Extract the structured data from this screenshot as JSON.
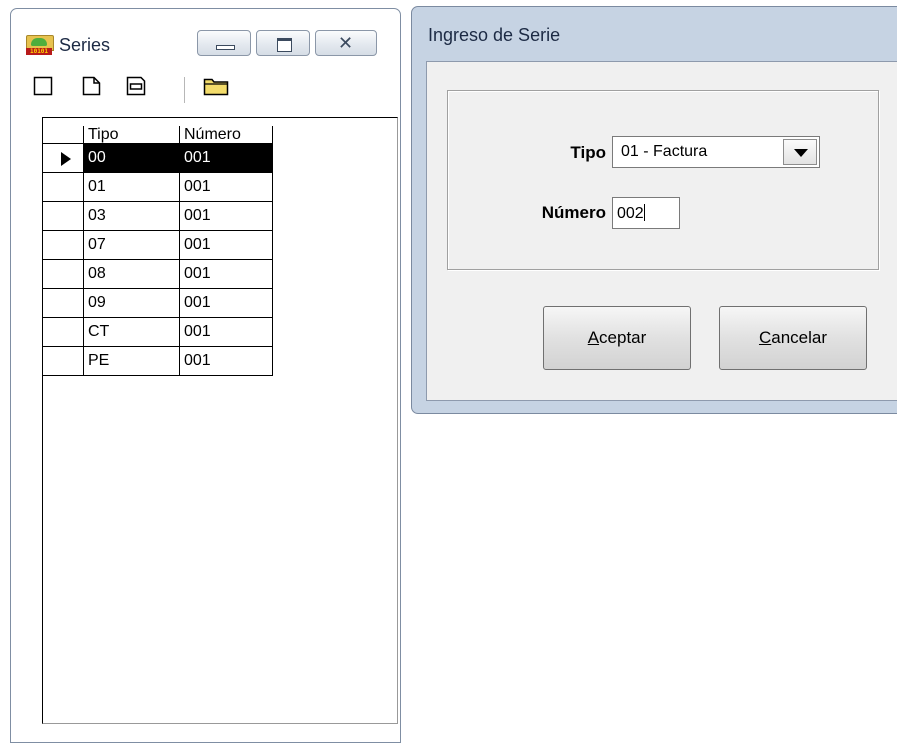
{
  "series_window": {
    "title": "Series",
    "toolbar": {
      "icons": [
        "new-blank-icon",
        "new-document-icon",
        "save-icon",
        "open-folder-icon"
      ]
    },
    "grid": {
      "columns": [
        "Tipo",
        "Número"
      ],
      "rows": [
        {
          "tipo": "00",
          "numero": "001",
          "selected": true
        },
        {
          "tipo": "01",
          "numero": "001"
        },
        {
          "tipo": "03",
          "numero": "001"
        },
        {
          "tipo": "07",
          "numero": "001"
        },
        {
          "tipo": "08",
          "numero": "001"
        },
        {
          "tipo": "09",
          "numero": "001"
        },
        {
          "tipo": "CT",
          "numero": "001"
        },
        {
          "tipo": "PE",
          "numero": "001"
        }
      ]
    }
  },
  "dialog": {
    "title": "Ingreso de Serie",
    "tipo_label": "Tipo",
    "tipo_value": "01 - Factura",
    "numero_label": "Número",
    "numero_value": "002",
    "accept": {
      "mnemonic": "A",
      "rest": "ceptar"
    },
    "cancel": {
      "mnemonic": "C",
      "rest": "ancelar"
    }
  },
  "colors": {
    "dialog_frame": "#c6d3e3",
    "dialog_client": "#f0f0f0",
    "selected_row": "#000000"
  }
}
